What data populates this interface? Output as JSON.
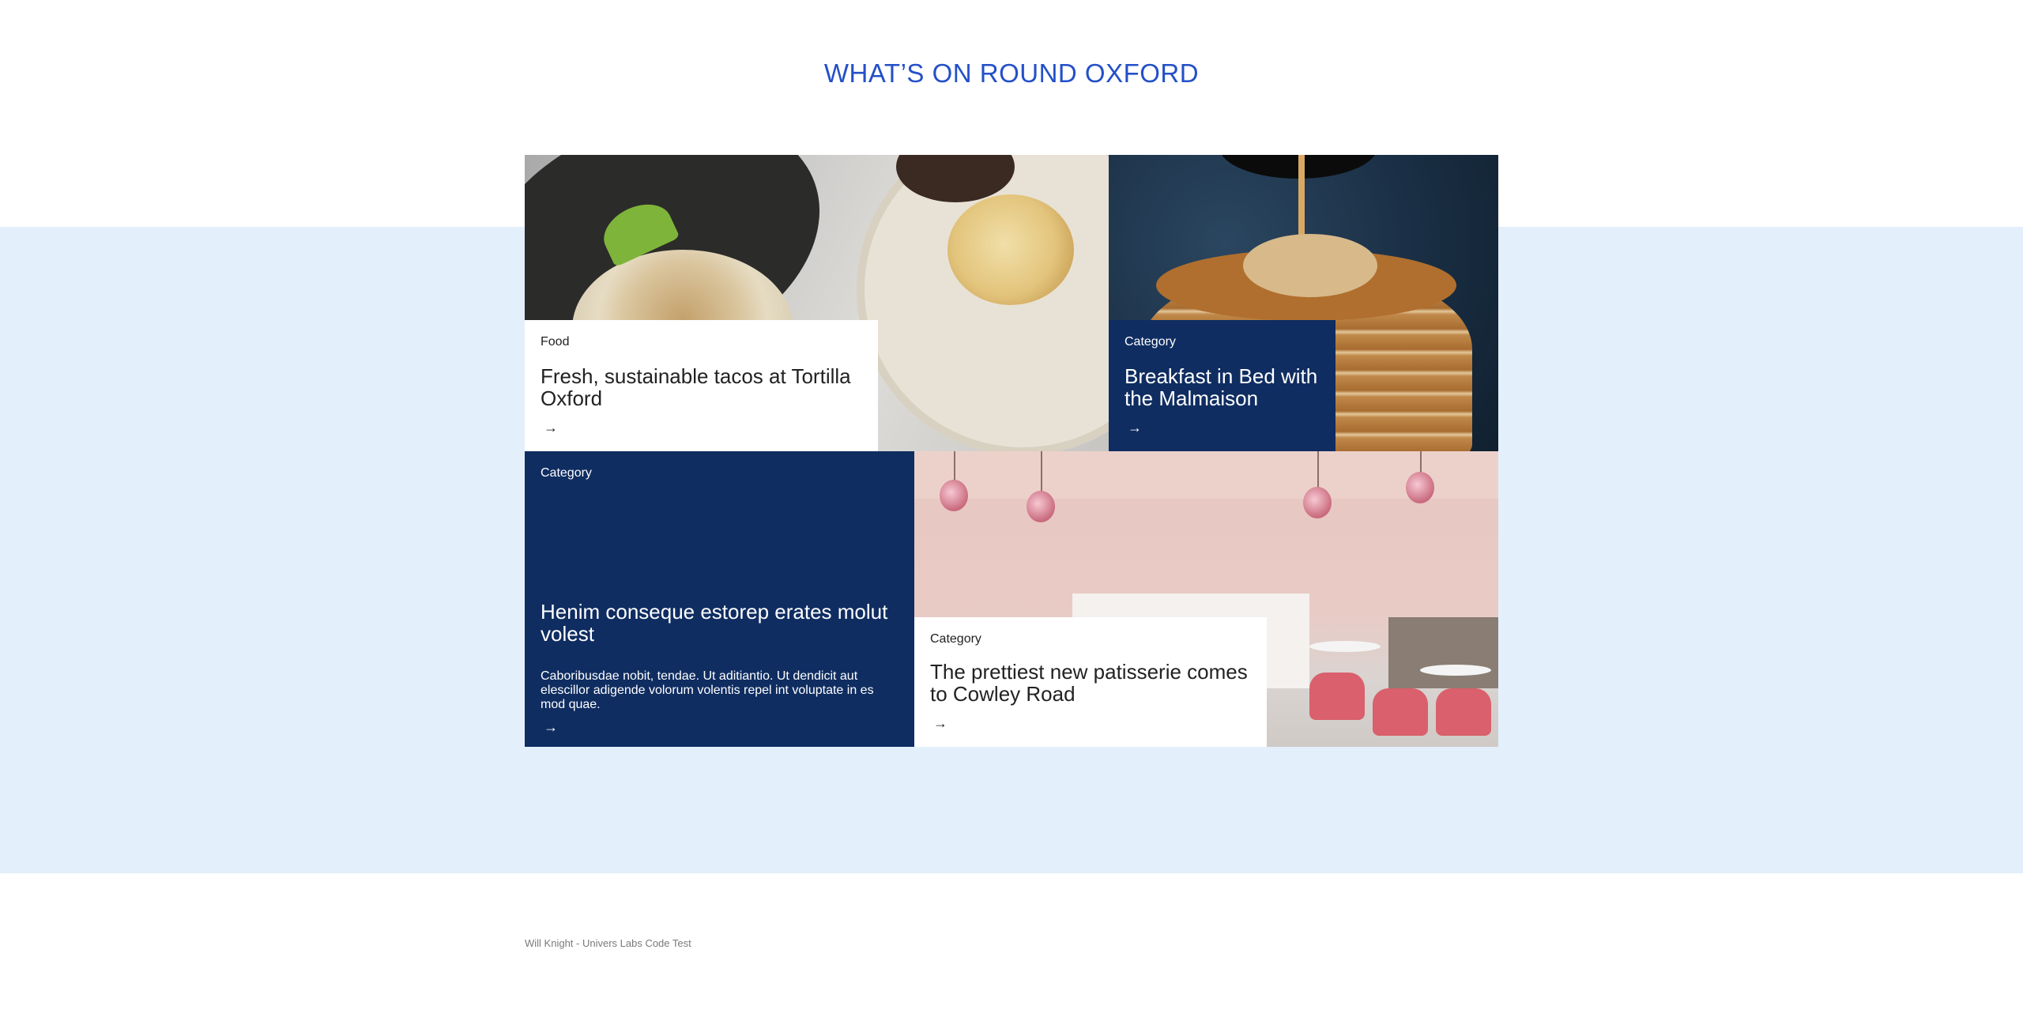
{
  "section": {
    "heading": "WHAT’S ON ROUND OXFORD"
  },
  "cards": [
    {
      "category": "Food",
      "title": "Fresh, sustainable tacos at Tortilla Oxford",
      "arrow": "→",
      "image_icon": "tacos-photo"
    },
    {
      "category": "Category",
      "title": "Breakfast in Bed with the Malmaison",
      "arrow": "→",
      "image_icon": "pancakes-photo"
    },
    {
      "category": "Category",
      "title": "Henim conseque estorep erates molut volest",
      "body": "Caboribusdae nobit, tendae. Ut aditiantio. Ut dendicit aut elescillor adigende volorum volentis repel int voluptate in es mod quae.",
      "arrow": "→"
    },
    {
      "category": "Category",
      "title": "The prettiest new patisserie comes to Cowley Road",
      "arrow": "→",
      "image_icon": "patisserie-photo"
    }
  ],
  "footer": {
    "text": "Will Knight - Univers Labs Code Test"
  },
  "colors": {
    "heading": "#2450c8",
    "band": "#e3f0fb",
    "navy": "#0f2d61",
    "white": "#ffffff"
  }
}
